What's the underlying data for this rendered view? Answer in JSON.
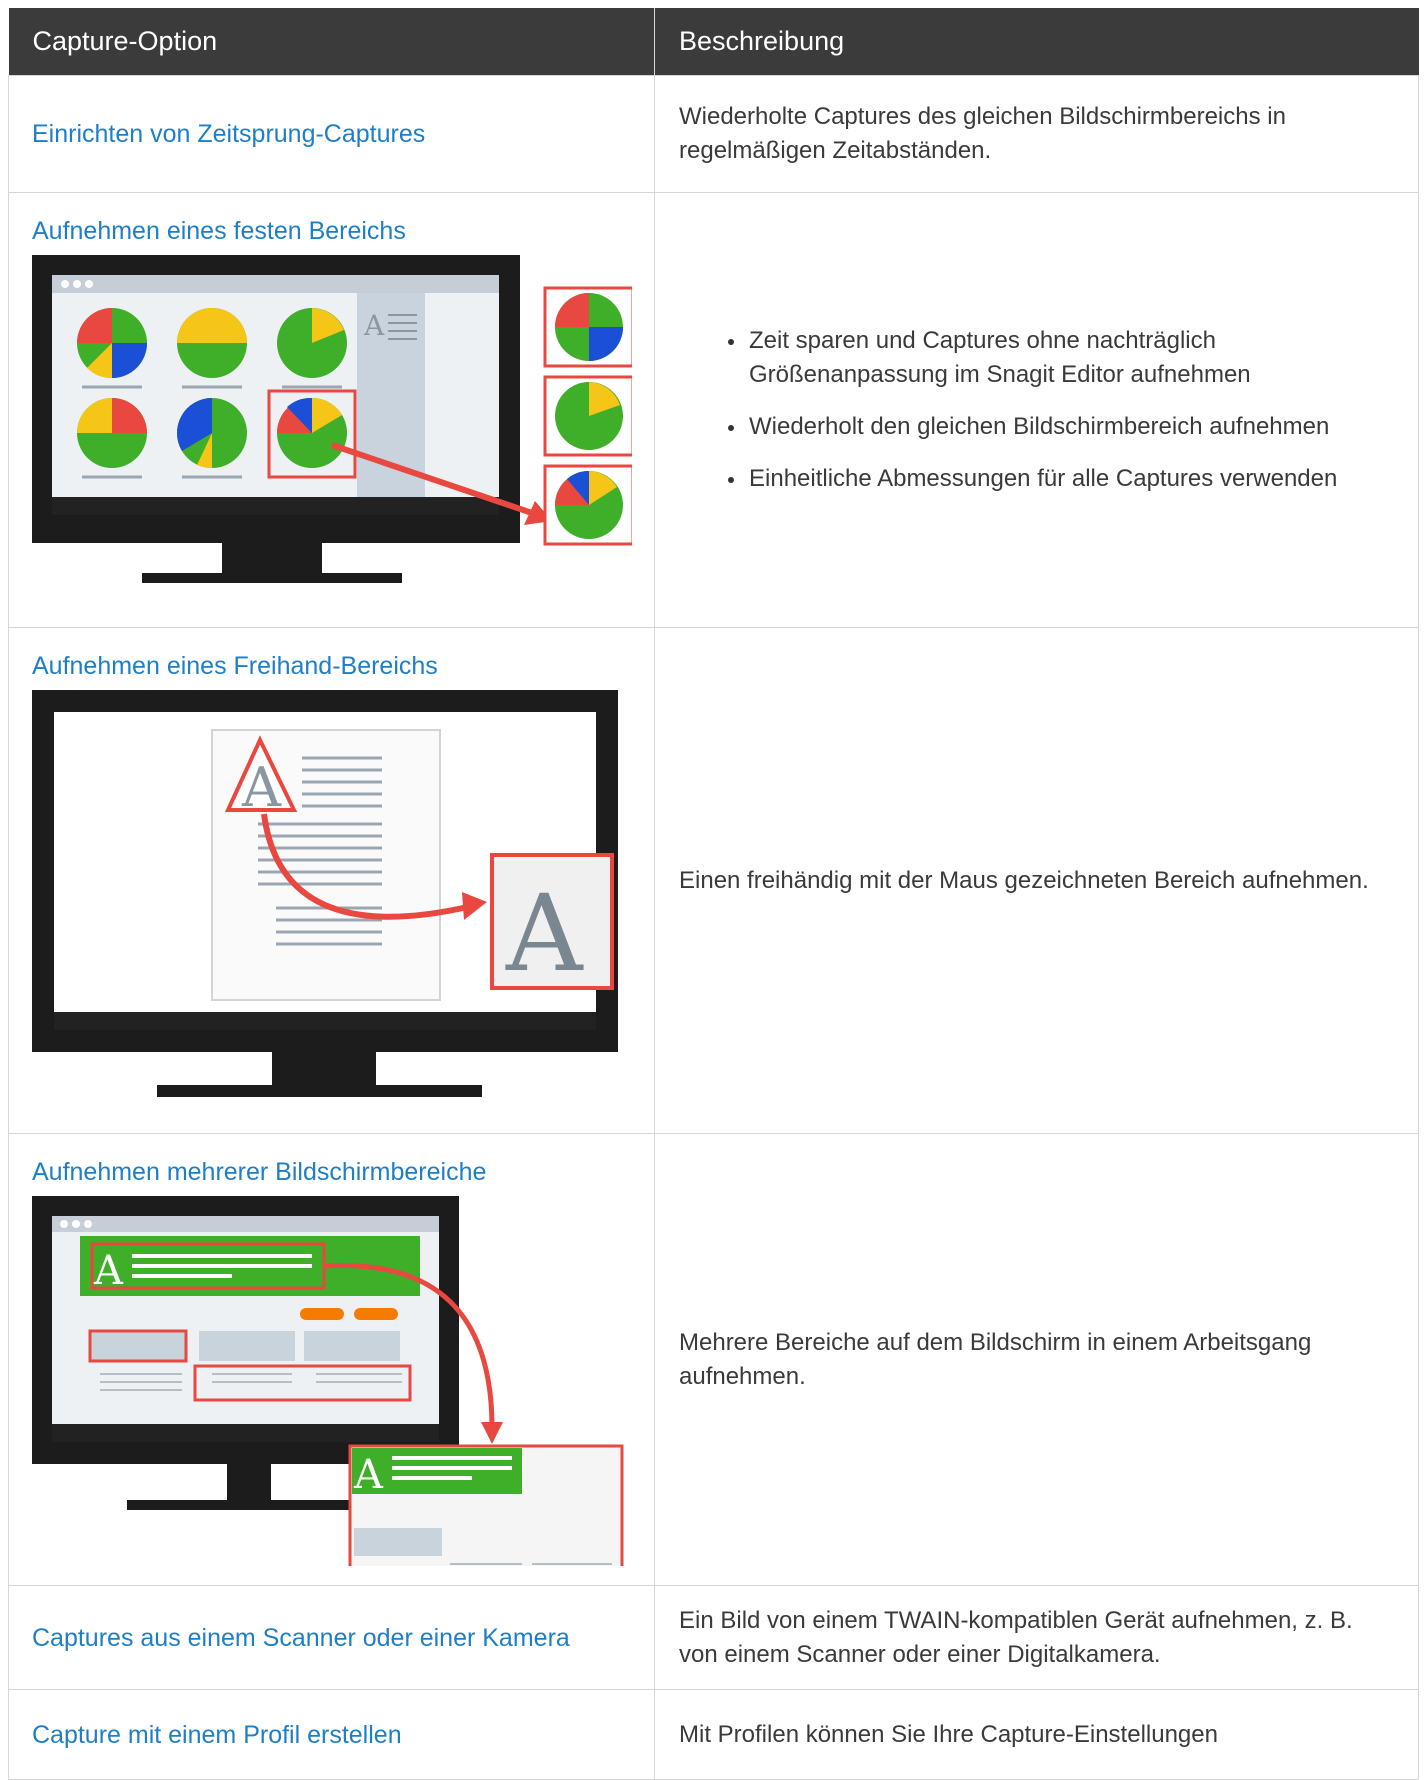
{
  "table": {
    "headers": {
      "option": "Capture-Option",
      "description": "Beschreibung"
    },
    "rows": [
      {
        "option": "Einrichten von Zeitsprung-Captures",
        "description": "Wiederholte Captures des gleichen Bildschirmbereichs in regelmäßigen Zeitabständen."
      },
      {
        "option": "Aufnehmen eines festen Bereichs",
        "bullets": [
          "Zeit sparen und Captures ohne nachträglich Größenanpassung im Snagit Editor aufnehmen",
          "Wiederholt den gleichen Bildschirmbereich aufnehmen",
          "Einheitliche Abmessungen für alle Captures verwenden"
        ]
      },
      {
        "option": "Aufnehmen eines Freihand-Bereichs",
        "description": "Einen freihändig mit der Maus gezeichneten Bereich aufnehmen."
      },
      {
        "option": "Aufnehmen mehrerer Bildschirmbereiche",
        "description": "Mehrere Bereiche auf dem Bildschirm in einem Arbeitsgang aufnehmen."
      },
      {
        "option": "Captures aus einem Scanner oder einer Kamera",
        "description": "Ein Bild von einem TWAIN-kompatiblen Gerät aufnehmen, z. B. von einem Scanner oder einer Digitalkamera."
      },
      {
        "option": "Capture mit einem Profil erstellen",
        "description": "Mit Profilen können Sie Ihre Capture-Einstellungen"
      }
    ]
  },
  "illustrations": {
    "letter": "A",
    "colors": {
      "red": "#e8483f",
      "green": "#3fae29",
      "yellow": "#f5c518",
      "blue": "#1a4fd6",
      "orange": "#f57c00",
      "gray": "#c9d3dc",
      "link": "#1e7fc6",
      "header_bg": "#3b3b3b"
    }
  }
}
